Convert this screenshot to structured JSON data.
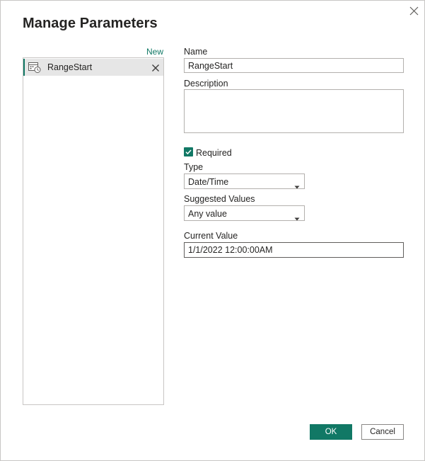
{
  "dialog": {
    "title": "Manage Parameters",
    "new_link": "New",
    "close_icon": "close-icon"
  },
  "parameters": [
    {
      "label": "RangeStart",
      "icon": "calendar-clock-icon",
      "remove_icon": "remove-icon",
      "selected": true
    }
  ],
  "form": {
    "name_label": "Name",
    "name_value": "RangeStart",
    "description_label": "Description",
    "description_value": "",
    "required_label": "Required",
    "required_checked": true,
    "type_label": "Type",
    "type_value": "Date/Time",
    "suggested_label": "Suggested Values",
    "suggested_value": "Any value",
    "current_label": "Current Value",
    "current_value": "1/1/2022 12:00:00AM"
  },
  "buttons": {
    "ok": "OK",
    "cancel": "Cancel"
  },
  "colors": {
    "accent": "#117865",
    "selected_bg": "#e6e6e6",
    "border": "#c8c6c4"
  }
}
